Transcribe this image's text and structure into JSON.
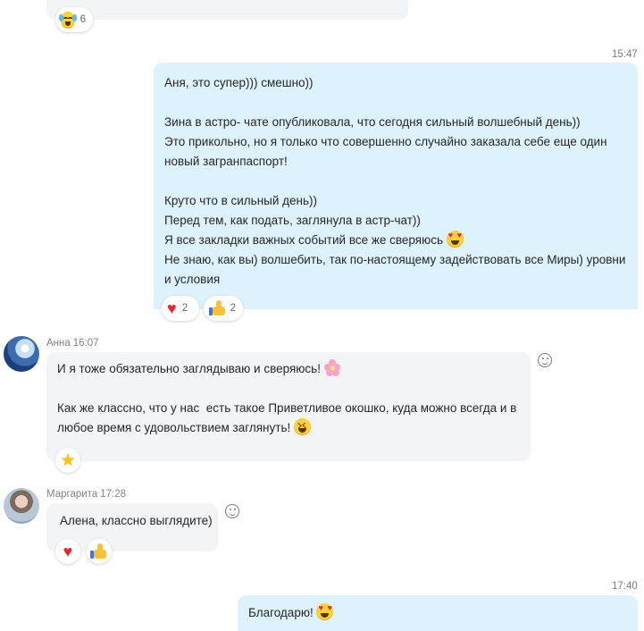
{
  "top_reaction": {
    "icon": "laughing-tears-icon",
    "count": "6"
  },
  "outgoing_1": {
    "time": "15:47",
    "lines": [
      "Аня, это супер))) смешно))",
      "",
      "Зина в астро- чате опубликовала, что сегодня сильный волшебный день))",
      "Это прикольно, но я только что совершенно случайно заказала себе еще один",
      "новый загранпаспорт!",
      "",
      "Круто что в сильный день))",
      "Перед тем, как подать, заглянула в астр-чат))",
      "Я все закладки важных событий все же сверяюсь",
      "Не знаю, как вы) волшебить, так по-настоящему задействовать все Миры) уровни",
      "и условия"
    ],
    "reactions": [
      {
        "icon": "red-heart-icon",
        "count": "2"
      },
      {
        "icon": "thumbs-up-icon",
        "count": "2"
      }
    ]
  },
  "anna_message": {
    "author": "Анна",
    "time": "16:07",
    "lines": [
      "И я тоже обязательно заглядываю и сверяюсь!",
      "",
      "Как же классно, что у нас  есть такое Приветливое окошко, куда можно всегда и в",
      "любое время с удовольствием заглянуть!"
    ],
    "reactions": [
      {
        "icon": "star-icon"
      }
    ]
  },
  "margarita_message": {
    "author": "Маргарита",
    "time": "17:28",
    "text": "Алена, классно выглядите)",
    "reactions": [
      {
        "icon": "red-heart-icon"
      },
      {
        "icon": "thumbs-up-icon"
      }
    ]
  },
  "outgoing_2": {
    "time": "17:40",
    "text": "Благодарю!"
  },
  "colors": {
    "outgoing_bubble": "#ddf2fd",
    "incoming_bubble": "#f2f4f6",
    "heart": "#e8252f"
  }
}
